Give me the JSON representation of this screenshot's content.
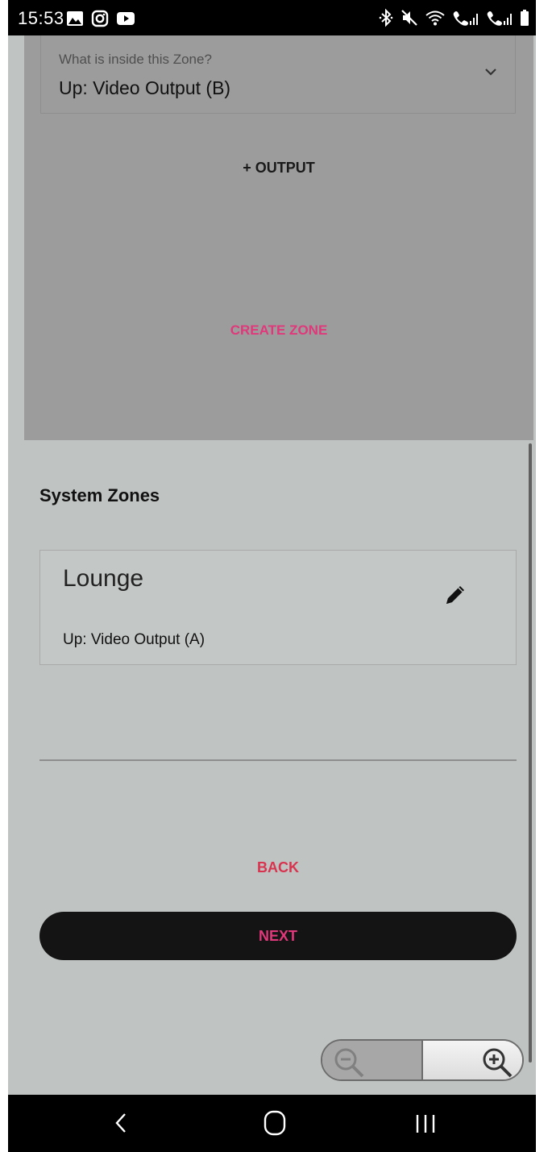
{
  "status_bar": {
    "time": "15:53",
    "left_icons": [
      "gallery-icon",
      "instagram-icon",
      "youtube-icon"
    ],
    "right_icons": [
      "bluetooth-icon",
      "mute-icon",
      "wifi-icon",
      "signal-sim1-icon",
      "signal-sim2-icon",
      "battery-icon"
    ]
  },
  "zone_form": {
    "select_label": "What is inside this Zone?",
    "select_value": "Up: Video Output (B)",
    "add_output_label": "+ OUTPUT",
    "create_zone_label": "CREATE ZONE"
  },
  "system_zones": {
    "title": "System Zones",
    "zones": [
      {
        "name": "Lounge",
        "detail": "Up: Video Output (A)"
      }
    ]
  },
  "footer": {
    "back_label": "BACK",
    "next_label": "NEXT"
  },
  "zoom_control": {
    "zoom_out_icon": "zoom-out-icon",
    "zoom_in_icon": "zoom-in-icon"
  },
  "nav_bar": {
    "icons": [
      "nav-back-icon",
      "nav-home-icon",
      "nav-recents-icon"
    ]
  },
  "colors": {
    "accent_pink": "#e0387a",
    "back_red": "#d8334f",
    "screen_bg": "#bfc3c2",
    "dim_panel": "#9c9c9c",
    "button_dark": "#141414"
  }
}
